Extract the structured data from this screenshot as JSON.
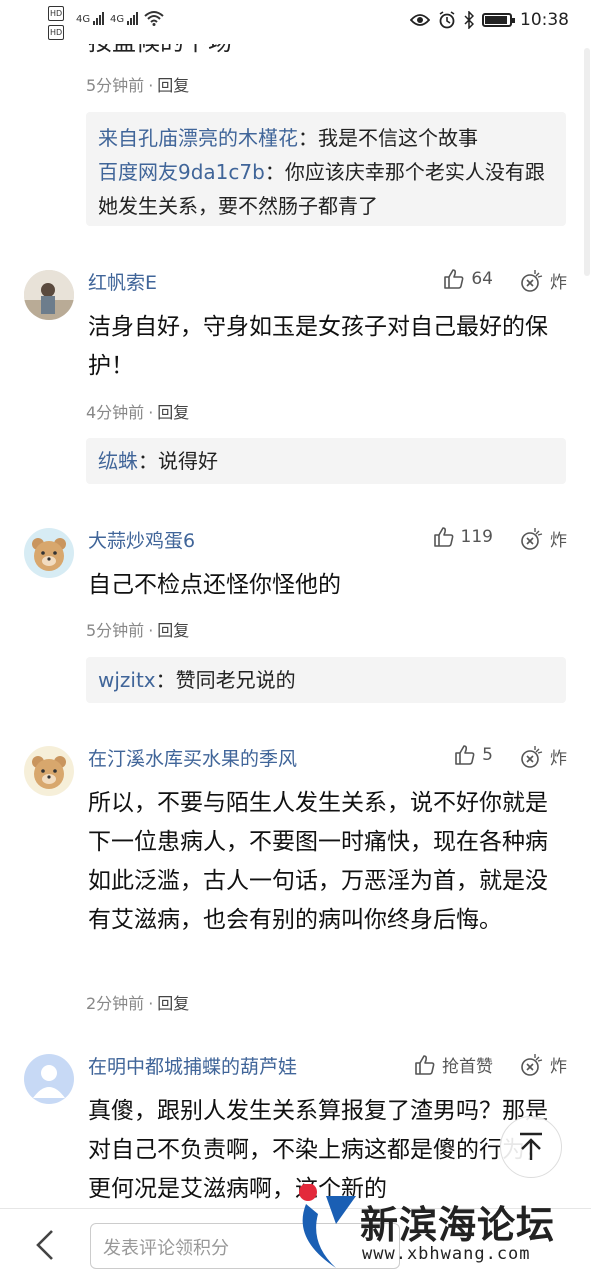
{
  "status_bar": {
    "hd1": "HD",
    "hd2": "HD",
    "net1": "4G",
    "net2": "4G",
    "time": "10:38"
  },
  "top_partial": {
    "cut_text": "按盘候的下场",
    "time": "5分钟前",
    "reply_label": "回复",
    "replies": [
      {
        "name": "来自孔庙漂亮的木槿花",
        "text": "：我是不信这个故事"
      },
      {
        "name": "百度网友9da1c7b",
        "text": "：你应该庆幸那个老实人没有跟她发生关系，要不然肠子都青了"
      }
    ]
  },
  "comments": [
    {
      "username": "红帆索E",
      "likes": "64",
      "bomb_label": "炸",
      "text": "洁身自好，守身如玉是女孩子对自己最好的保护！",
      "time": "4分钟前",
      "reply_label": "回复",
      "replies": [
        {
          "name": "纮蛛",
          "text": "：说得好"
        }
      ]
    },
    {
      "username": "大蒜炒鸡蛋6",
      "likes": "119",
      "bomb_label": "炸",
      "text": "自己不检点还怪你怪他的",
      "time": "5分钟前",
      "reply_label": "回复",
      "replies": [
        {
          "name": "wjzitx",
          "text": "：赞同老兄说的"
        }
      ]
    },
    {
      "username": "在汀溪水库买水果的季风",
      "likes": "5",
      "bomb_label": "炸",
      "text": "所以，不要与陌生人发生关系，说不好你就是下一位患病人，不要图一时痛快，现在各种病如此泛滥，古人一句话，万恶淫为首，就是没有艾滋病，也会有别的病叫你终身后悔。",
      "time": "2分钟前",
      "reply_label": "回复"
    },
    {
      "username": "在明中都城捕蝶的葫芦娃",
      "likes": "抢首赞",
      "bomb_label": "炸",
      "text": "真傻，跟别人发生关系算报复了渣男吗？那是对自己不负责啊，不染上病这都是傻的行为，更何况是艾滋病啊，这个新的"
    }
  ],
  "bottom_bar": {
    "input_placeholder": "发表评论领积分"
  },
  "watermark": {
    "title": "新滨海论坛",
    "url": "www.xbhwang.com"
  }
}
